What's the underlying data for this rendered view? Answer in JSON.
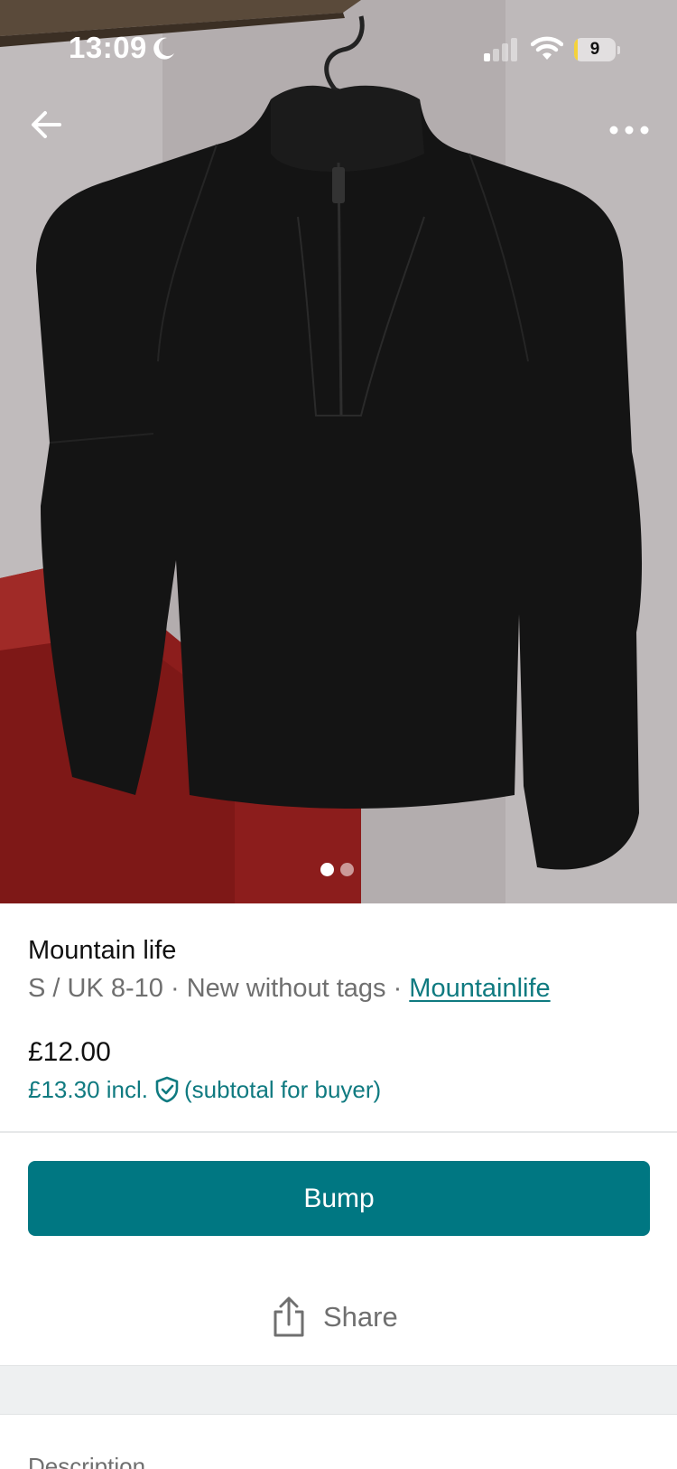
{
  "status_bar": {
    "time": "13:09",
    "battery": "9",
    "battery_level": 0.09,
    "icons": [
      "moon-icon",
      "signal-icon",
      "wifi-icon",
      "battery-icon"
    ]
  },
  "nav": {
    "back_icon": "arrow-left-icon",
    "more_icon": "ellipsis-icon"
  },
  "gallery": {
    "current_index": 1,
    "total": 2,
    "alt": "Black half-zip long sleeve top on a hanger"
  },
  "item": {
    "title": "Mountain life",
    "size": "S / UK 8-10",
    "separator": " · ",
    "condition": "New without tags",
    "brand": "Mountainlife",
    "price": "£12.00",
    "price_incl": "£13.30 incl.",
    "price_incl_note": "(subtotal for buyer)"
  },
  "actions": {
    "bump_label": "Bump",
    "share_label": "Share"
  },
  "description": {
    "heading": "Description"
  },
  "colors": {
    "accent": "#007782",
    "link": "#0f7a80",
    "muted_text": "#6f6f6f"
  }
}
